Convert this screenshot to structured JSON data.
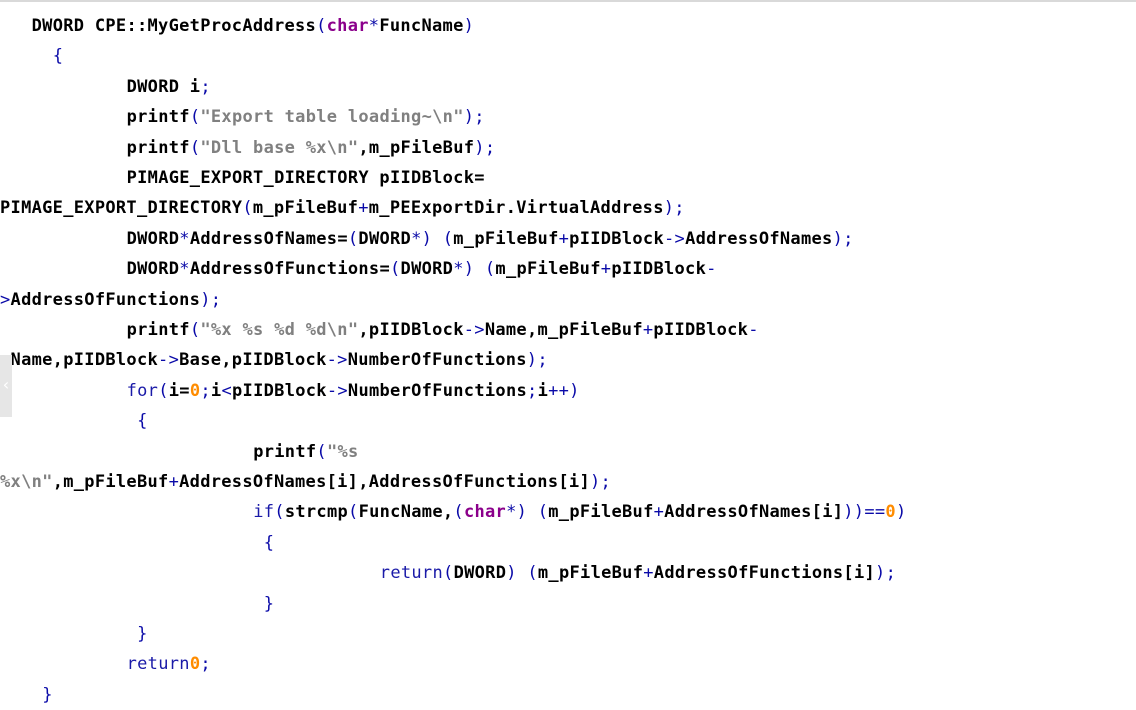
{
  "code_lines": [
    {
      "indent": 3,
      "segments": [
        {
          "t": "DWORD CPE::MyGetProcAddress",
          "c": "b"
        },
        {
          "t": "(",
          "c": "op"
        },
        {
          "t": "char",
          "c": "kw"
        },
        {
          "t": "*",
          "c": "op"
        },
        {
          "t": "FuncName",
          "c": "b"
        },
        {
          "t": ")",
          "c": "op"
        }
      ]
    },
    {
      "indent": 5,
      "segments": [
        {
          "t": "{",
          "c": "op"
        }
      ]
    },
    {
      "indent": 12,
      "segments": [
        {
          "t": "DWORD i",
          "c": "b"
        },
        {
          "t": ";",
          "c": "op"
        }
      ]
    },
    {
      "indent": 12,
      "segments": [
        {
          "t": "printf",
          "c": "b"
        },
        {
          "t": "(",
          "c": "op"
        },
        {
          "t": "\"Export table loading~\\n\"",
          "c": "str"
        },
        {
          "t": ");",
          "c": "op"
        }
      ]
    },
    {
      "indent": 12,
      "segments": [
        {
          "t": "printf",
          "c": "b"
        },
        {
          "t": "(",
          "c": "op"
        },
        {
          "t": "\"Dll base %x\\n\"",
          "c": "str"
        },
        {
          "t": ",m_pFileBuf",
          "c": "b"
        },
        {
          "t": ");",
          "c": "op"
        }
      ]
    },
    {
      "indent": 12,
      "segments": [
        {
          "t": "PIMAGE_EXPORT_DIRECTORY pIIDBlock=",
          "c": "b"
        }
      ]
    },
    {
      "indent": 0,
      "segments": [
        {
          "t": "PIMAGE_EXPORT_DIRECTORY",
          "c": "b"
        },
        {
          "t": "(",
          "c": "op"
        },
        {
          "t": "m_pFileBuf",
          "c": "b"
        },
        {
          "t": "+",
          "c": "op"
        },
        {
          "t": "m_PEExportDir.VirtualAddress",
          "c": "b"
        },
        {
          "t": ");",
          "c": "op"
        }
      ]
    },
    {
      "indent": 12,
      "segments": [
        {
          "t": "DWORD",
          "c": "b"
        },
        {
          "t": "*",
          "c": "op"
        },
        {
          "t": "AddressOfNames=",
          "c": "b"
        },
        {
          "t": "(",
          "c": "op"
        },
        {
          "t": "DWORD",
          "c": "b"
        },
        {
          "t": "*)",
          "c": "op"
        },
        {
          "t": " ",
          "c": "b"
        },
        {
          "t": "(",
          "c": "op"
        },
        {
          "t": "m_pFileBuf",
          "c": "b"
        },
        {
          "t": "+",
          "c": "op"
        },
        {
          "t": "pIIDBlock",
          "c": "b"
        },
        {
          "t": "->",
          "c": "op"
        },
        {
          "t": "AddressOfNames",
          "c": "b"
        },
        {
          "t": ");",
          "c": "op"
        }
      ]
    },
    {
      "indent": 12,
      "segments": [
        {
          "t": "DWORD",
          "c": "b"
        },
        {
          "t": "*",
          "c": "op"
        },
        {
          "t": "AddressOfFunctions=",
          "c": "b"
        },
        {
          "t": "(",
          "c": "op"
        },
        {
          "t": "DWORD",
          "c": "b"
        },
        {
          "t": "*)",
          "c": "op"
        },
        {
          "t": " ",
          "c": "b"
        },
        {
          "t": "(",
          "c": "op"
        },
        {
          "t": "m_pFileBuf",
          "c": "b"
        },
        {
          "t": "+",
          "c": "op"
        },
        {
          "t": "pIIDBlock",
          "c": "b"
        },
        {
          "t": "-",
          "c": "op"
        }
      ]
    },
    {
      "indent": 0,
      "segments": [
        {
          "t": ">",
          "c": "op"
        },
        {
          "t": "AddressOfFunctions",
          "c": "b"
        },
        {
          "t": ");",
          "c": "op"
        }
      ]
    },
    {
      "indent": 12,
      "segments": [
        {
          "t": "printf",
          "c": "b"
        },
        {
          "t": "(",
          "c": "op"
        },
        {
          "t": "\"%x %s %d %d\\n\"",
          "c": "str"
        },
        {
          "t": ",pIIDBlock",
          "c": "b"
        },
        {
          "t": "->",
          "c": "op"
        },
        {
          "t": "Name,m_pFileBuf",
          "c": "b"
        },
        {
          "t": "+",
          "c": "op"
        },
        {
          "t": "pIIDBlock",
          "c": "b"
        },
        {
          "t": "-",
          "c": "op"
        }
      ]
    },
    {
      "indent": 0,
      "segments": [
        {
          "t": ">",
          "c": "op"
        },
        {
          "t": "Name,pIIDBlock",
          "c": "b"
        },
        {
          "t": "->",
          "c": "op"
        },
        {
          "t": "Base,pIIDBlock",
          "c": "b"
        },
        {
          "t": "->",
          "c": "op"
        },
        {
          "t": "NumberOfFunctions",
          "c": "b"
        },
        {
          "t": ");",
          "c": "op"
        }
      ]
    },
    {
      "indent": 12,
      "segments": [
        {
          "t": "for",
          "c": "plain"
        },
        {
          "t": "(",
          "c": "op"
        },
        {
          "t": "i=",
          "c": "b"
        },
        {
          "t": "0",
          "c": "num"
        },
        {
          "t": ";",
          "c": "op"
        },
        {
          "t": "i",
          "c": "b"
        },
        {
          "t": "<",
          "c": "op"
        },
        {
          "t": "pIIDBlock",
          "c": "b"
        },
        {
          "t": "->",
          "c": "op"
        },
        {
          "t": "NumberOfFunctions",
          "c": "b"
        },
        {
          "t": ";",
          "c": "op"
        },
        {
          "t": "i",
          "c": "b"
        },
        {
          "t": "++)",
          "c": "op"
        }
      ]
    },
    {
      "indent": 13,
      "segments": [
        {
          "t": "{",
          "c": "op"
        }
      ]
    },
    {
      "indent": 24,
      "segments": [
        {
          "t": "printf",
          "c": "b"
        },
        {
          "t": "(",
          "c": "op"
        },
        {
          "t": "\"%s",
          "c": "str"
        }
      ]
    },
    {
      "indent": 0,
      "segments": [
        {
          "t": "%x\\n\"",
          "c": "str"
        },
        {
          "t": ",m_pFileBuf",
          "c": "b"
        },
        {
          "t": "+",
          "c": "op"
        },
        {
          "t": "AddressOfNames[i],AddressOfFunctions[i]",
          "c": "b"
        },
        {
          "t": ");",
          "c": "op"
        }
      ]
    },
    {
      "indent": 24,
      "segments": [
        {
          "t": "if",
          "c": "plain"
        },
        {
          "t": "(",
          "c": "op"
        },
        {
          "t": "strcmp",
          "c": "b"
        },
        {
          "t": "(",
          "c": "op"
        },
        {
          "t": "FuncName,",
          "c": "b"
        },
        {
          "t": "(",
          "c": "op"
        },
        {
          "t": "char",
          "c": "kw"
        },
        {
          "t": "*)",
          "c": "op"
        },
        {
          "t": " ",
          "c": "b"
        },
        {
          "t": "(",
          "c": "op"
        },
        {
          "t": "m_pFileBuf",
          "c": "b"
        },
        {
          "t": "+",
          "c": "op"
        },
        {
          "t": "AddressOfNames[i]",
          "c": "b"
        },
        {
          "t": "))==",
          "c": "op"
        },
        {
          "t": "0",
          "c": "num"
        },
        {
          "t": ")",
          "c": "op"
        }
      ]
    },
    {
      "indent": 25,
      "segments": [
        {
          "t": "{",
          "c": "op"
        }
      ]
    },
    {
      "indent": 36,
      "segments": [
        {
          "t": "return",
          "c": "plain"
        },
        {
          "t": "(",
          "c": "op"
        },
        {
          "t": "DWORD",
          "c": "b"
        },
        {
          "t": ")",
          "c": "op"
        },
        {
          "t": " ",
          "c": "b"
        },
        {
          "t": "(",
          "c": "op"
        },
        {
          "t": "m_pFileBuf",
          "c": "b"
        },
        {
          "t": "+",
          "c": "op"
        },
        {
          "t": "AddressOfFunctions[i]",
          "c": "b"
        },
        {
          "t": ");",
          "c": "op"
        }
      ]
    },
    {
      "indent": 25,
      "segments": [
        {
          "t": "}",
          "c": "op"
        }
      ]
    },
    {
      "indent": 13,
      "segments": [
        {
          "t": "}",
          "c": "op"
        }
      ]
    },
    {
      "indent": 12,
      "segments": [
        {
          "t": "return",
          "c": "plain"
        },
        {
          "t": "0",
          "c": "num"
        },
        {
          "t": ";",
          "c": "op"
        }
      ]
    },
    {
      "indent": 4,
      "segments": [
        {
          "t": "}",
          "c": "op"
        }
      ]
    }
  ],
  "icons": {
    "side_handle": "chevron-left-icon"
  },
  "colors": {
    "background": "#ffffff",
    "keyword": "#8b008b",
    "string": "#808080",
    "number": "#ff8c00",
    "operator": "#0a0aa8",
    "identifier": "#000000"
  }
}
